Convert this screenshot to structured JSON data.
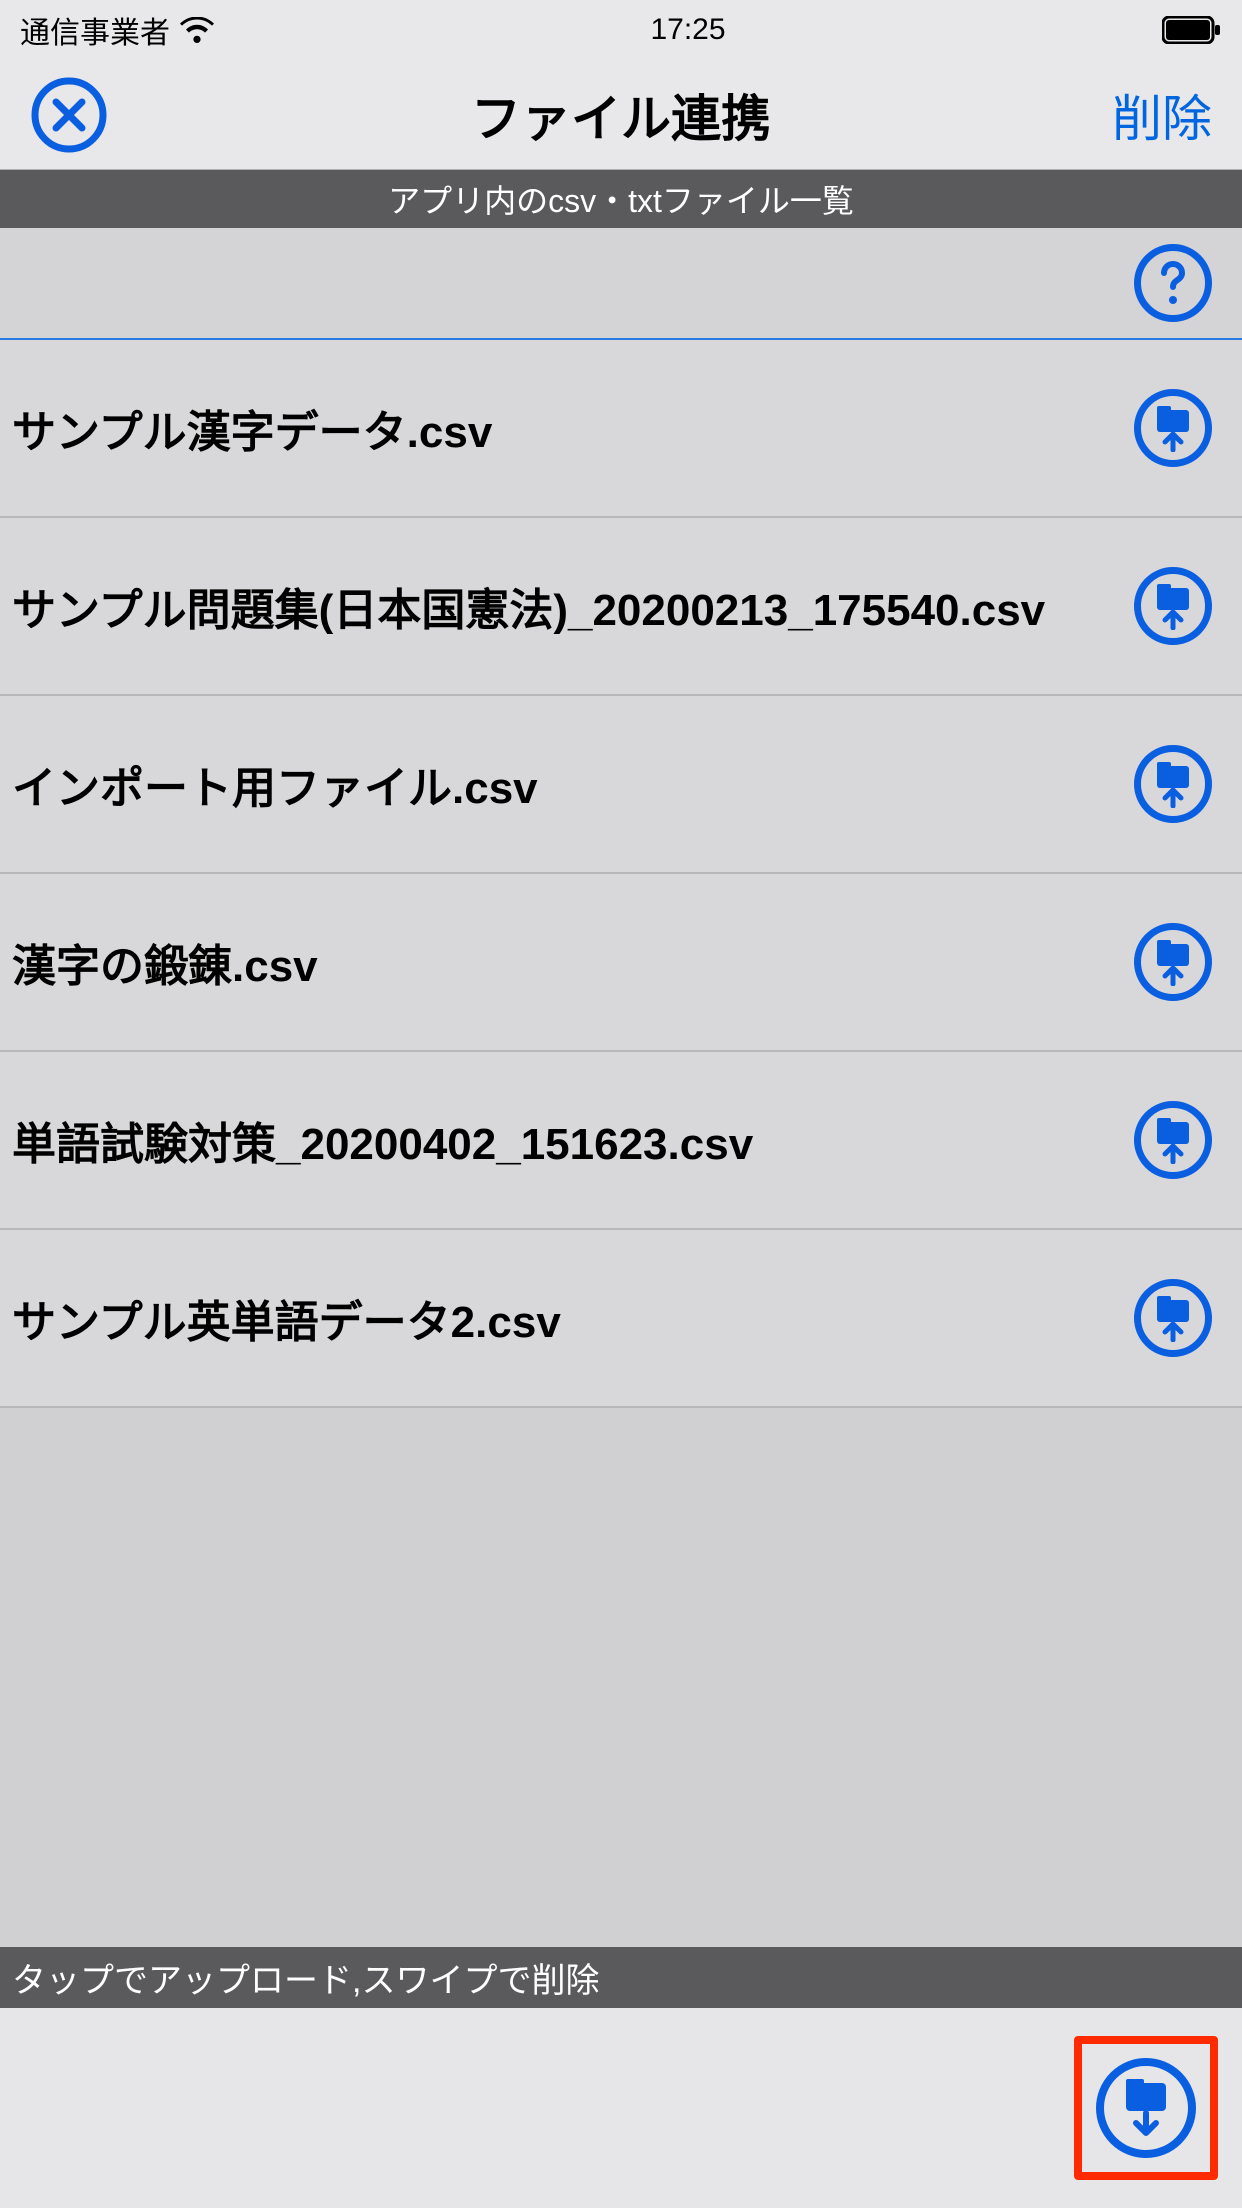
{
  "status_bar": {
    "carrier": "通信事業者",
    "time": "17:25"
  },
  "nav": {
    "title": "ファイル連携",
    "delete_label": "削除"
  },
  "section_header": "アプリ内のcsv・txtファイル一覧",
  "files": [
    {
      "name": "サンプル漢字データ.csv"
    },
    {
      "name": "サンプル問題集(日本国憲法)_20200213_175540.csv"
    },
    {
      "name": "インポート用ファイル.csv"
    },
    {
      "name": "漢字の鍛錬.csv"
    },
    {
      "name": "単語試験対策_20200402_151623.csv"
    },
    {
      "name": "サンプル英単語データ2.csv"
    }
  ],
  "hint": "タップでアップロード,スワイプで削除",
  "colors": {
    "accent": "#0a5ee0",
    "highlight": "#ff2a00"
  }
}
